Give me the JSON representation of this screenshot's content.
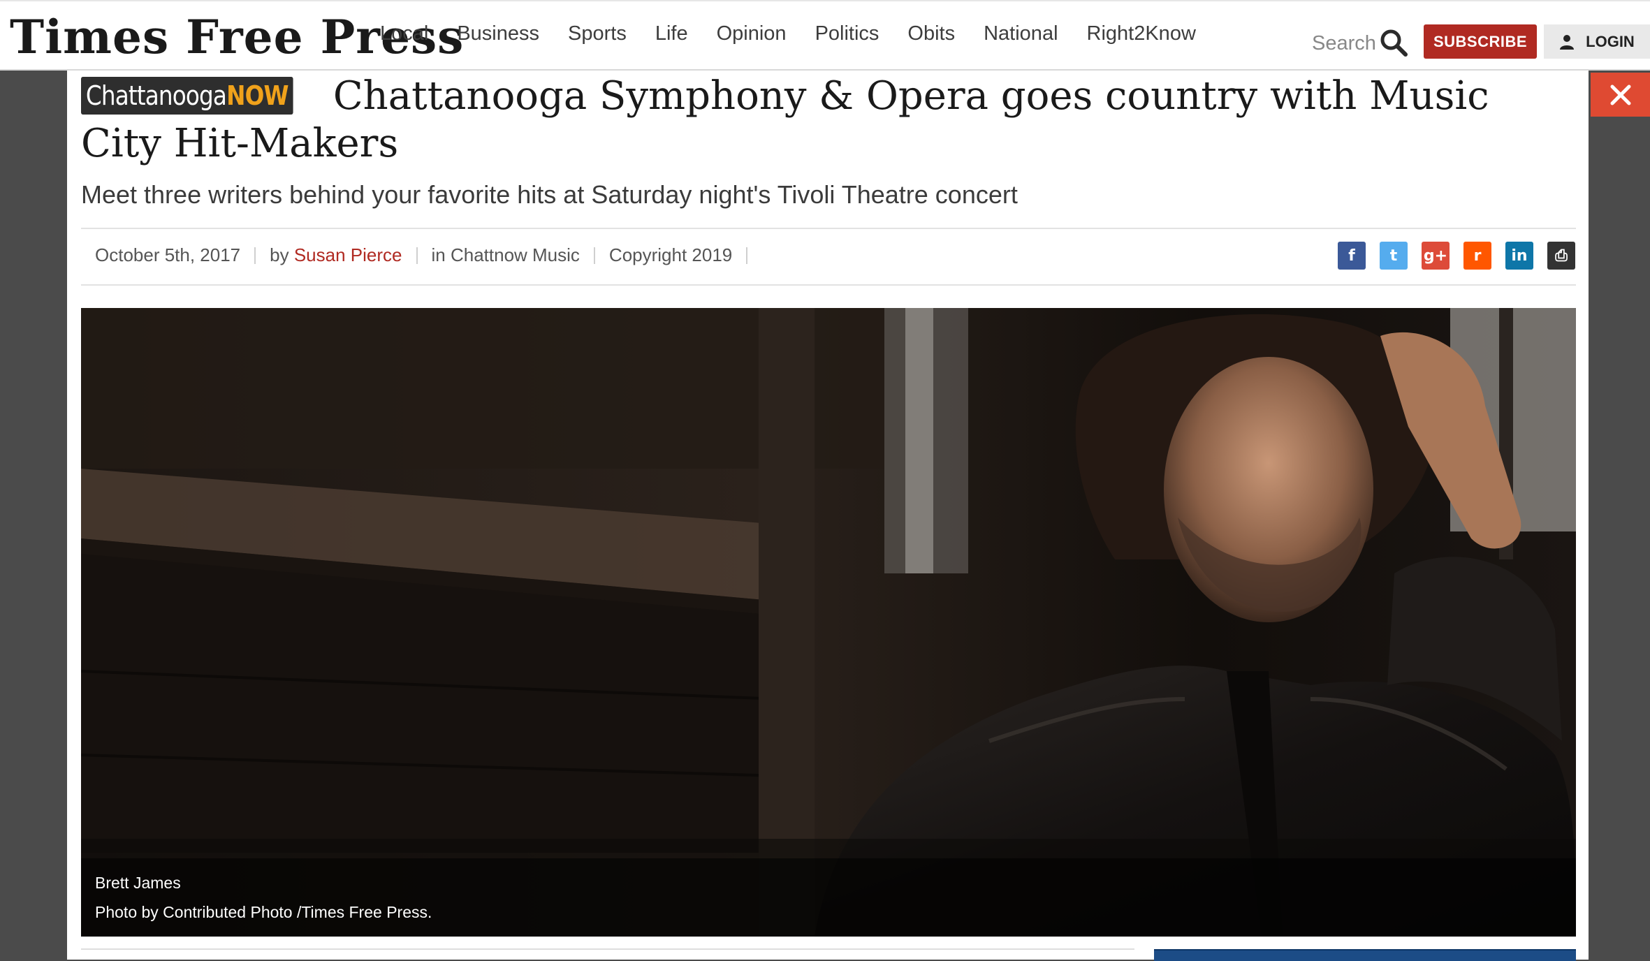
{
  "header": {
    "logo": "Times Free Press",
    "nav": [
      "Local",
      "Business",
      "Sports",
      "Life",
      "Opinion",
      "Politics",
      "Obits",
      "National",
      "Right2Know"
    ],
    "search_label": "Search",
    "subscribe_label": "SUBSCRIBE",
    "login_label": "LOGIN"
  },
  "article": {
    "badge_main": "Chattanooga",
    "badge_accent": "NOW",
    "title": "Chattanooga Symphony & Opera goes country with Music City Hit-Makers",
    "subtitle": "Meet three writers behind your favorite hits at Saturday night's Tivoli Theatre concert",
    "date": "October 5th, 2017",
    "by_prefix": "by",
    "author": "Susan Pierce",
    "section": "in Chattnow Music",
    "copyright": "Copyright 2019",
    "share": [
      {
        "name": "facebook",
        "glyph": "f",
        "color": "#3b5998"
      },
      {
        "name": "twitter",
        "glyph": "t",
        "color": "#55acee"
      },
      {
        "name": "google-plus",
        "glyph": "g+",
        "color": "#dd4b39"
      },
      {
        "name": "reddit",
        "glyph": "r",
        "color": "#ff5700"
      },
      {
        "name": "linkedin",
        "glyph": "in",
        "color": "#0e76a8"
      },
      {
        "name": "print",
        "glyph": "⎙",
        "color": "#333333"
      }
    ],
    "caption_name": "Brett James",
    "caption_credit": "Photo by Contributed Photo /Times Free Press."
  },
  "colors": {
    "brand_red": "#b02a22",
    "close_bg": "#df4a32",
    "badge_accent": "#f0a21b"
  },
  "icons": {
    "search": "search-icon",
    "user": "user-icon",
    "close": "close-icon"
  }
}
